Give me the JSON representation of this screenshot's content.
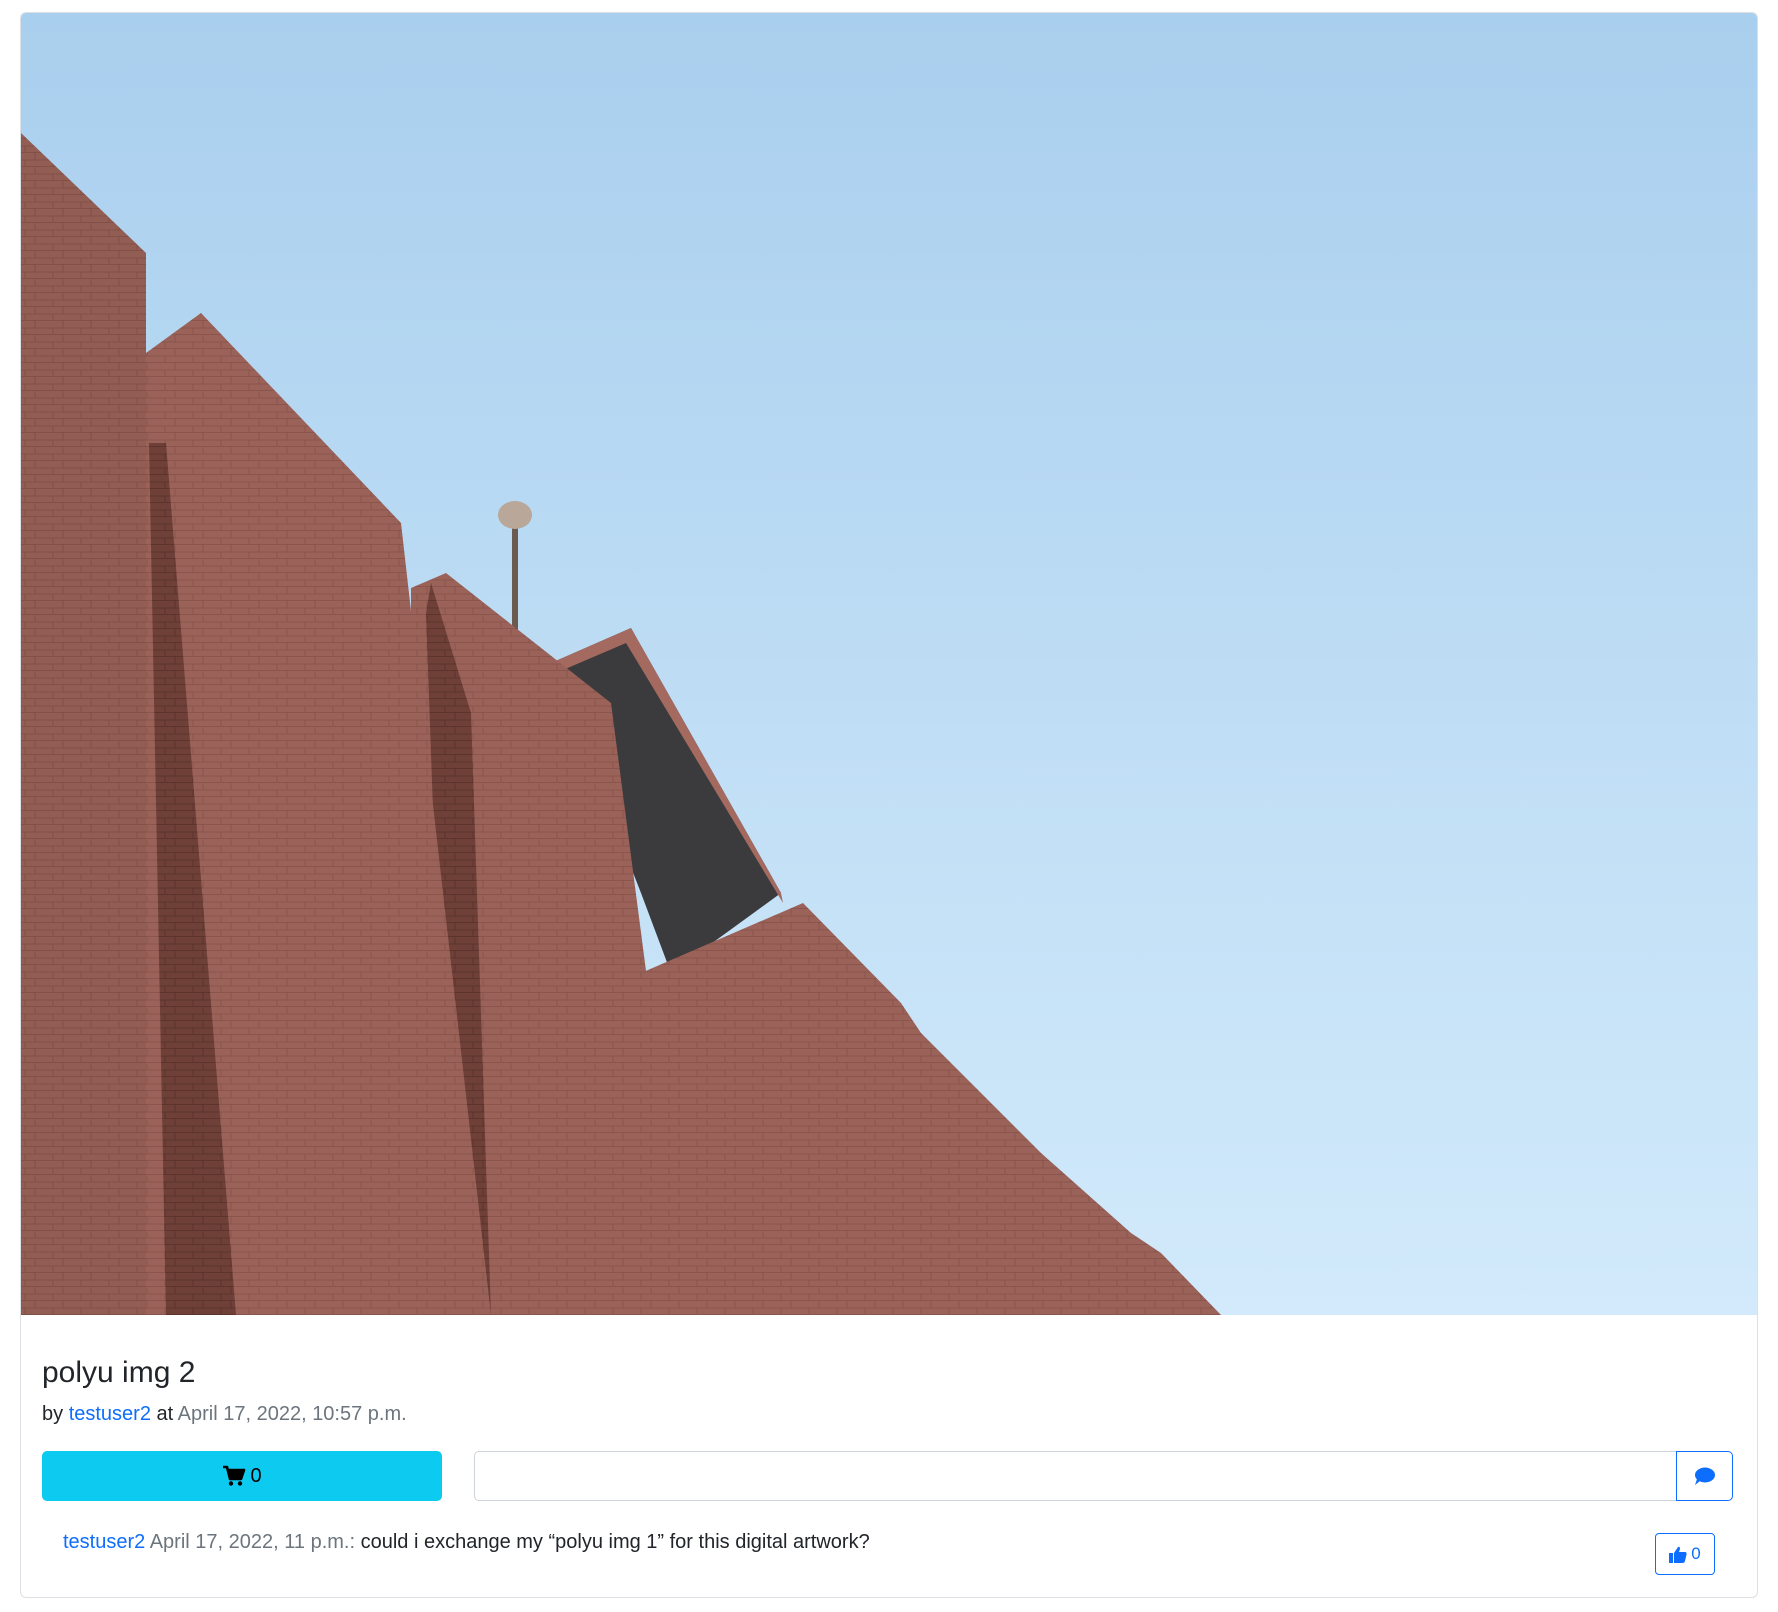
{
  "post": {
    "title": "polyu img 2",
    "by_label": "by",
    "author": "testuser2",
    "at_label": "at",
    "timestamp": "April 17, 2022, 10:57 p.m.",
    "image_alt": "Brick building against blue sky"
  },
  "actions": {
    "cart_icon": "shopping-cart-icon",
    "cart_count": "0",
    "comment_input_value": "",
    "send_icon": "comment-icon"
  },
  "comments": [
    {
      "author": "testuser2",
      "timestamp": "April 17, 2022, 11 p.m.:",
      "text": "could i exchange my “polyu img 1” for this digital artwork?",
      "like_icon": "thumbs-up-icon",
      "likes": "0"
    }
  ],
  "colors": {
    "info": "#0dcaf0",
    "primary": "#0d6efd",
    "muted": "#6c757d",
    "sky_top": "#a9cfee",
    "sky_bottom": "#d2eafb",
    "brick": "#9a6258"
  }
}
